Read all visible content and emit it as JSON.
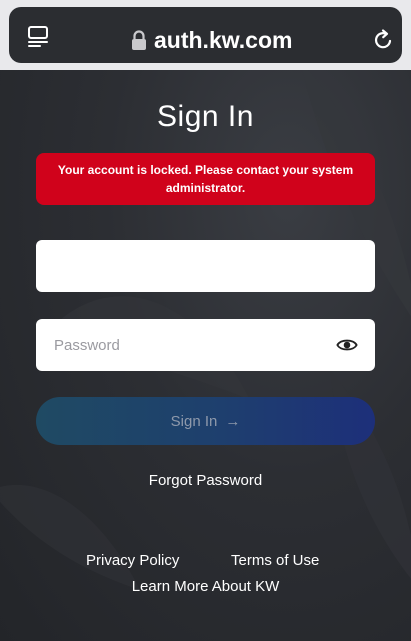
{
  "browser": {
    "url": "auth.kw.com",
    "icons": {
      "tabs": "tabs-icon",
      "lock": "lock-icon",
      "reload": "reload-icon"
    }
  },
  "signin": {
    "title": "Sign In",
    "alert": "Your account is locked. Please contact your system administrator.",
    "email": {
      "value": "",
      "placeholder": ""
    },
    "password": {
      "value": "",
      "placeholder": "Password"
    },
    "button_label": "Sign In",
    "button_arrow": "→",
    "forgot_password": "Forgot Password"
  },
  "footer": {
    "privacy": "Privacy Policy",
    "terms": "Terms of Use",
    "learn_more": "Learn More About KW"
  },
  "colors": {
    "alert": "#d0021b",
    "button_gradient_start": "#1f4a63",
    "button_gradient_end": "#1d2f7a",
    "background": "#2c2e33"
  }
}
